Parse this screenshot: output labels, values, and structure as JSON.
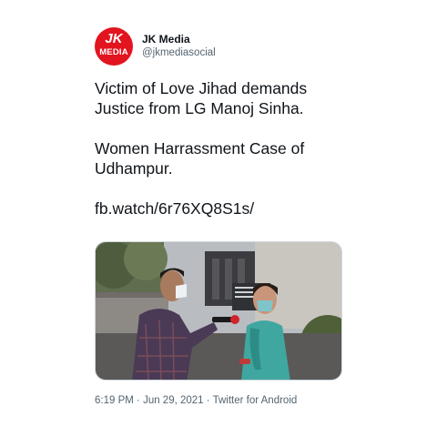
{
  "user": {
    "avatar_mark": "JK",
    "avatar_text": "MEDIA",
    "display_name": "JK Media",
    "handle": "@jkmediasocial"
  },
  "tweet": {
    "line1": "Victim of Love Jihad demands",
    "line2": "Justice from LG Manoj Sinha.",
    "line3": "Women Harrassment Case of",
    "line4": "Udhampur.",
    "link": "fb.watch/6r76XQ8S1s/"
  },
  "meta": {
    "time": "6:19 PM",
    "date": "Jun 29, 2021",
    "source": "Twitter for Android",
    "separator": " · "
  },
  "colors": {
    "brand_red": "#e2141f",
    "text": "#0f1419",
    "muted": "#536471"
  }
}
